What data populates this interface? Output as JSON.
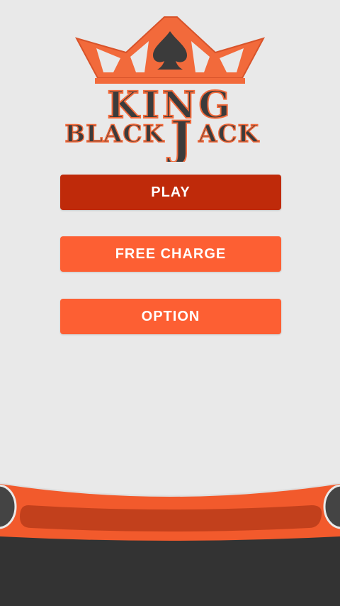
{
  "logo": {
    "line1": "KING",
    "line2_left": "BLACK",
    "line2_right": "ACK",
    "big_letter": "J"
  },
  "menu": {
    "play_label": "PLAY",
    "free_charge_label": "FREE CHARGE",
    "option_label": "OPTION"
  },
  "colors": {
    "background": "#e9e9e9",
    "play_button": "#bf2a0a",
    "secondary_button": "#fd5f33",
    "logo_orange": "#f26a3b",
    "logo_dark": "#3b3b3b",
    "table_rail": "#f25a2c",
    "table_dark": "#333333"
  },
  "icons": [
    "crown-icon",
    "spade-icon"
  ]
}
